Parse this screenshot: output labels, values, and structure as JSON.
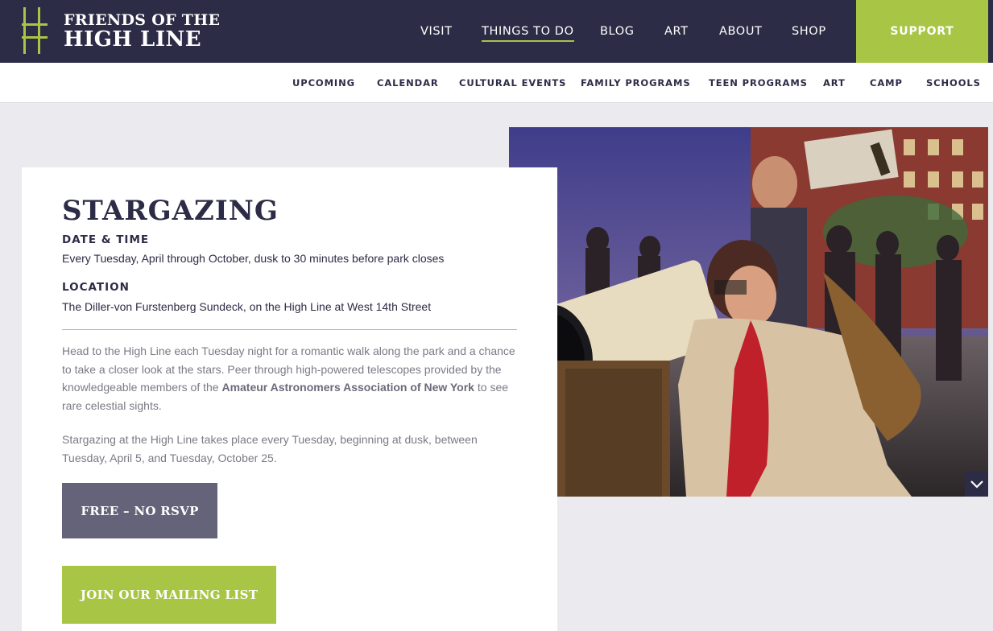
{
  "logo": {
    "line1": "FRIENDS OF THE",
    "line2": "HIGH LINE"
  },
  "nav": {
    "items": [
      "VISIT",
      "THINGS TO DO",
      "BLOG",
      "ART",
      "ABOUT",
      "SHOP"
    ],
    "active": "THINGS TO DO",
    "support": "SUPPORT"
  },
  "subnav": {
    "items": [
      "UPCOMING",
      "CALENDAR",
      "CULTURAL EVENTS",
      "FAMILY PROGRAMS",
      "TEEN PROGRAMS",
      "ART",
      "CAMP",
      "SCHOOLS"
    ]
  },
  "event": {
    "title": "STARGAZING",
    "datetime_label": "DATE & TIME",
    "datetime_value": "Every Tuesday, April through October, dusk to 30 minutes before park closes",
    "location_label": "LOCATION",
    "location_value": "The Diller-von Furstenberg Sundeck, on the High Line at West 14th Street",
    "para1_a": "Head to the High Line each Tuesday night for a romantic walk along the park and a chance to take a closer look at the stars. Peer through high-powered telescopes provided by the knowledgeable members of the ",
    "para1_link": "Amateur Astronomers Association of New York",
    "para1_b": " to see rare celestial sights.",
    "para2": "Stargazing at the High Line takes place every Tuesday, beginning at dusk, between Tuesday, April 5, and Tuesday, October 25.",
    "rsvp_button": "FREE – NO RSVP",
    "mailing_button": "JOIN OUR MAILING LIST"
  },
  "colors": {
    "navy": "#2d2c46",
    "green": "#a8c545",
    "gray_button": "#64637a"
  }
}
